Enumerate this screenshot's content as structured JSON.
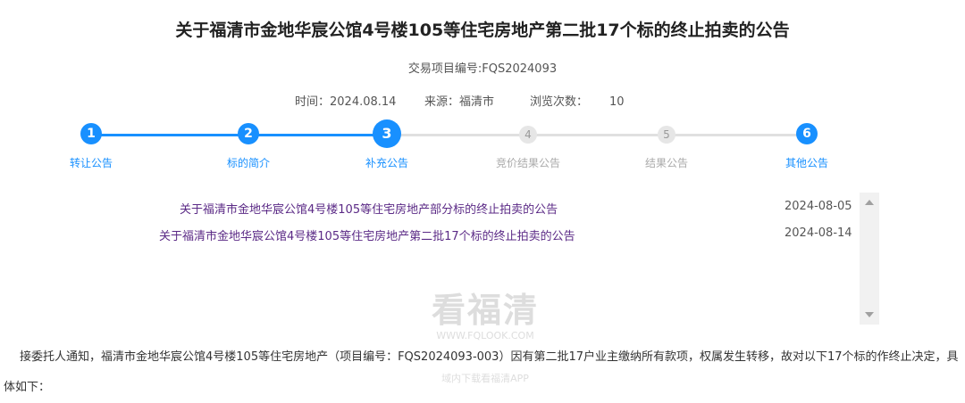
{
  "title": "关于福清市金地华宸公馆4号楼105等住宅房地产第二批17个标的终止拍卖的公告",
  "project_no": "交易项目编号:FQS2024093",
  "meta": {
    "time": "时间：2024.08.14",
    "source": "来源：福清市",
    "views_label": "浏览次数：",
    "views_value": "10"
  },
  "steps": [
    {
      "num": "1",
      "label": "转让公告",
      "state": "active"
    },
    {
      "num": "2",
      "label": "标的简介",
      "state": "active"
    },
    {
      "num": "3",
      "label": "补充公告",
      "state": "current"
    },
    {
      "num": "4",
      "label": "竞价结果公告",
      "state": "inactive"
    },
    {
      "num": "5",
      "label": "结果公告",
      "state": "inactive"
    },
    {
      "num": "6",
      "label": "其他公告",
      "state": "active"
    }
  ],
  "announcements": [
    {
      "title": "关于福清市金地华宸公馆4号楼105等住宅房地产部分标的终止拍卖的公告",
      "date": "2024-08-05"
    },
    {
      "title": "关于福清市金地华宸公馆4号楼105等住宅房地产第二批17个标的终止拍卖的公告",
      "date": "2024-08-14"
    }
  ],
  "body": "接委托人通知，福清市金地华宸公馆4号楼105等住宅房地产（项目编号：FQS2024093-003）因有第二批17户业主缴纳所有款项，权属发生转移，故对以下17个标的作终止决定，具体如下：",
  "watermark": {
    "brand": "看福清",
    "url": "WWW.FQLOOK.COM",
    "app": "域内下载看福清APP"
  },
  "colors": {
    "accent": "#1890ff",
    "link": "#5b2a86"
  }
}
